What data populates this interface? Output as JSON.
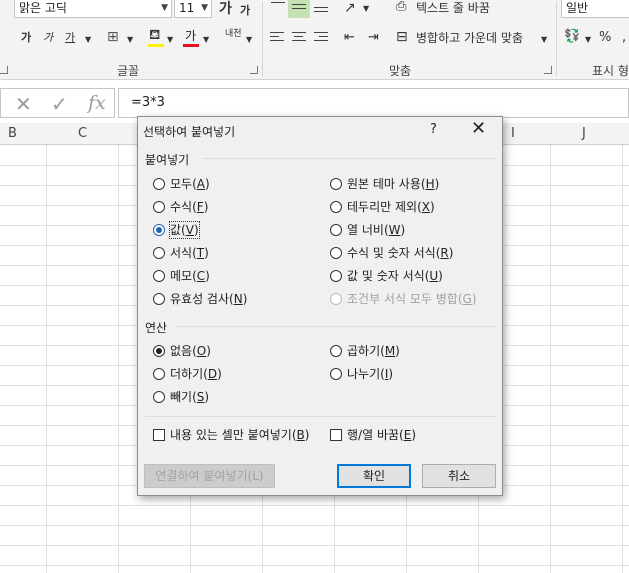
{
  "ribbon": {
    "font_name": "맑은 고딕",
    "font_size": "11",
    "font_group_label": "글꼴",
    "align_group_label": "맞춤",
    "number_group_label": "표시 형",
    "wrap_text_label": "텍스트 줄 바꿈",
    "merge_center_label": "병합하고 가운데 맞춤",
    "number_format": "일반",
    "percent_symbol": "%",
    "bold_label": "가",
    "italic_label": "가",
    "underline_label": "가",
    "grow_font_label": "가",
    "shrink_font_label": "가",
    "font_color_label": "가",
    "phonetic_label": "내천",
    "accent_color": "#217346",
    "font_color": "#e81123",
    "highlight_color": "#ffef00"
  },
  "formula_bar": {
    "cancel_symbol": "✕",
    "enter_symbol": "✓",
    "fx_symbol": "fx",
    "formula": "=3*3"
  },
  "columns": [
    "B",
    "C",
    "I",
    "J"
  ],
  "dialog": {
    "title": "선택하여 붙여넣기",
    "help": "?",
    "close": "✕",
    "paste_section": "붙여넣기",
    "paste_left": [
      {
        "text": "모두",
        "key": "A",
        "selected": false
      },
      {
        "text": "수식",
        "key": "F",
        "selected": false
      },
      {
        "text": "값",
        "key": "V",
        "selected": true
      },
      {
        "text": "서식",
        "key": "T",
        "selected": false
      },
      {
        "text": "메모",
        "key": "C",
        "selected": false
      },
      {
        "text": "유효성 검사",
        "key": "N",
        "selected": false
      }
    ],
    "paste_right": [
      {
        "text": "원본 테마 사용",
        "key": "H",
        "enabled": true
      },
      {
        "text": "테두리만 제외",
        "key": "X",
        "enabled": true
      },
      {
        "text": "열 너비",
        "key": "W",
        "enabled": true
      },
      {
        "text": "수식 및 숫자 서식",
        "key": "R",
        "enabled": true
      },
      {
        "text": "값 및 숫자 서식",
        "key": "U",
        "enabled": true
      },
      {
        "text": "조건부 서식 모두 병합",
        "key": "G",
        "enabled": false
      }
    ],
    "operation_section": "연산",
    "op_left": [
      {
        "text": "없음",
        "key": "O",
        "selected": true
      },
      {
        "text": "더하기",
        "key": "D",
        "selected": false
      },
      {
        "text": "빼기",
        "key": "S",
        "selected": false
      }
    ],
    "op_right": [
      {
        "text": "곱하기",
        "key": "M",
        "selected": false
      },
      {
        "text": "나누기",
        "key": "I",
        "selected": false
      }
    ],
    "skip_blanks": {
      "text": "내용 있는 셀만 붙여넣기",
      "key": "B"
    },
    "transpose": {
      "text": "행/열 바꿈",
      "key": "E"
    },
    "paste_link": {
      "text": "연결하여 붙여넣기",
      "key": "L"
    },
    "ok": "확인",
    "cancel": "취소"
  }
}
